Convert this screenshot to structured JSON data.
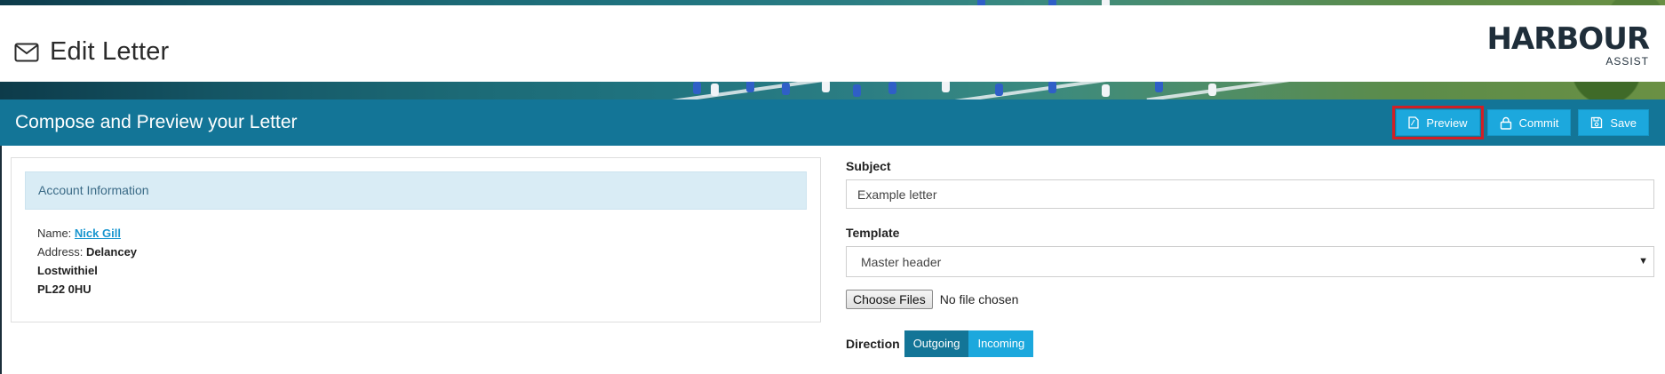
{
  "header": {
    "page_title": "Edit Letter",
    "page_icon": "envelope-icon",
    "logo_main": "HARBOUR",
    "logo_sub": "ASSIST"
  },
  "toolbar": {
    "title": "Compose and Preview your Letter",
    "preview_label": "Preview",
    "commit_label": "Commit",
    "save_label": "Save",
    "highlight_color": "#d11f25"
  },
  "account": {
    "section_title": "Account Information",
    "name_label": "Name:",
    "name_value": "Nick Gill",
    "address_label": "Address:",
    "address_line1": "Delancey",
    "address_line2": "Lostwithiel",
    "address_line3": "PL22 0HU"
  },
  "form": {
    "subject_label": "Subject",
    "subject_value": "Example letter",
    "template_label": "Template",
    "template_value": "Master header",
    "choose_files_label": "Choose Files",
    "no_file_text": "No file chosen",
    "direction_label": "Direction",
    "direction_outgoing": "Outgoing",
    "direction_incoming": "Incoming"
  },
  "colors": {
    "bar": "#137597",
    "button": "#1ca8dd",
    "panel_head": "#d9ecf5",
    "link": "#1a96cf"
  }
}
